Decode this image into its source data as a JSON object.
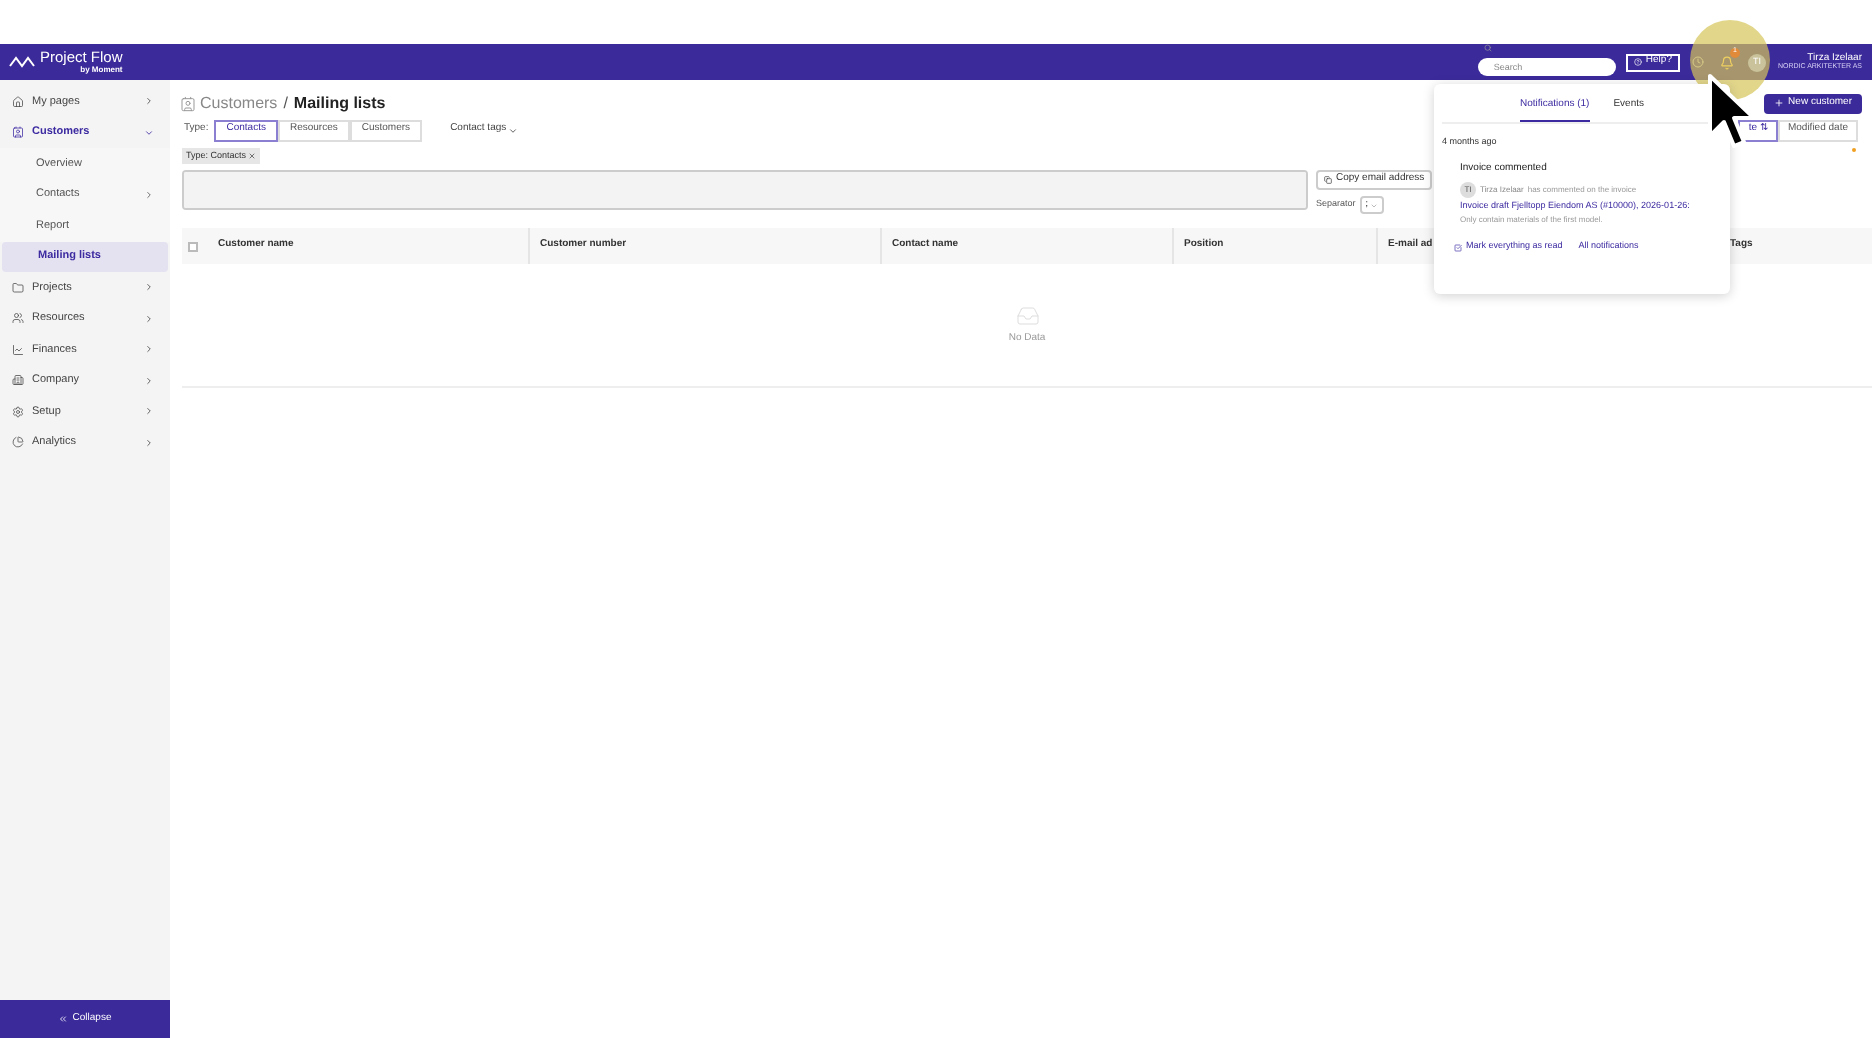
{
  "header": {
    "logo": "Project Flow",
    "logo_sub": "by Moment",
    "search": {
      "placeholder": "Search"
    },
    "help": "Help?",
    "notification_count": "1",
    "user": {
      "initials": "TI",
      "name": "Tirza Izelaar",
      "company": "NORDIC ARKITEKTER AS"
    }
  },
  "sidebar": {
    "items": [
      {
        "label": "My pages",
        "expanded": false,
        "selected": false
      },
      {
        "label": "Customers",
        "expanded": true,
        "selected": true,
        "children": [
          {
            "label": "Overview",
            "expandable": false,
            "selected": false
          },
          {
            "label": "Contacts",
            "expandable": true,
            "selected": false
          },
          {
            "label": "Report",
            "expandable": false,
            "selected": false
          },
          {
            "label": "Mailing lists",
            "expandable": false,
            "selected": true
          }
        ]
      },
      {
        "label": "Projects",
        "expanded": false,
        "selected": false
      },
      {
        "label": "Resources",
        "expanded": false,
        "selected": false
      },
      {
        "label": "Finances",
        "expanded": false,
        "selected": false
      },
      {
        "label": "Company",
        "expanded": false,
        "selected": false
      },
      {
        "label": "Setup",
        "expanded": false,
        "selected": false
      },
      {
        "label": "Analytics",
        "expanded": false,
        "selected": false
      }
    ],
    "collapse": "Collapse"
  },
  "breadcrumb": [
    "Customers",
    "Mailing lists"
  ],
  "breadcrumb_separator": "/",
  "type_filter": {
    "label": "Type:",
    "options": [
      {
        "label": "Contacts",
        "selected": true
      },
      {
        "label": "Resources",
        "selected": false
      },
      {
        "label": "Customers",
        "selected": false
      }
    ]
  },
  "contact_tags": "Contact tags",
  "chips": [
    "Type: Contacts"
  ],
  "copy_button": "Copy email address",
  "separator": {
    "label": "Separator",
    "value": ";"
  },
  "new_customer": "New customer",
  "sort_buttons": [
    {
      "label": "te ⇅",
      "selected": true
    },
    {
      "label": "Modified date",
      "selected": false
    }
  ],
  "table": {
    "select_all": {
      "checked": false
    },
    "columns": [
      "Customer name",
      "Customer number",
      "Contact name",
      "Position",
      "E-mail ad",
      "Tags"
    ],
    "empty": "No Data"
  },
  "notifications": {
    "tabs": [
      {
        "label": "Notifications (1)",
        "selected": true
      },
      {
        "label": "Events",
        "selected": false
      }
    ],
    "group": "4 months ago",
    "items": [
      {
        "title": "Invoice commented",
        "initials": "TI",
        "author": "Tirza Izelaar",
        "action": "has commented on the invoice",
        "link": "Invoice draft Fjelltopp Eiendom AS (#10000), 2026-01-26:",
        "comment": "Only contain materials of the first model."
      }
    ],
    "mark_all": "Mark everything as read",
    "all": "All notifications"
  }
}
